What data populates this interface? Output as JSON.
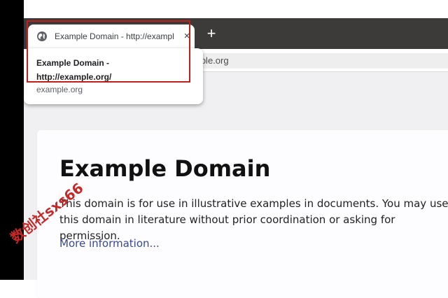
{
  "tab": {
    "title": "Example Domain - http://example.org/",
    "close_glyph": "×",
    "favicon": "globe-icon"
  },
  "new_tab": {
    "glyph": "+"
  },
  "omnibox": {
    "visible_text": "mple.org"
  },
  "hovercard": {
    "title": "Example Domain - http://example.org/",
    "domain": "example.org"
  },
  "page": {
    "heading": "Example Domain",
    "paragraph": "This domain is for use in illustrative examples in documents. You may use this domain in literature without prior coordination or asking for permission.",
    "link": "More information..."
  },
  "watermark": {
    "text": "数创社sxs66"
  },
  "colors": {
    "tabstrip": "#3c3b3a",
    "highlight": "#c0201c",
    "link": "#38488f",
    "watermark": "#c62828"
  }
}
